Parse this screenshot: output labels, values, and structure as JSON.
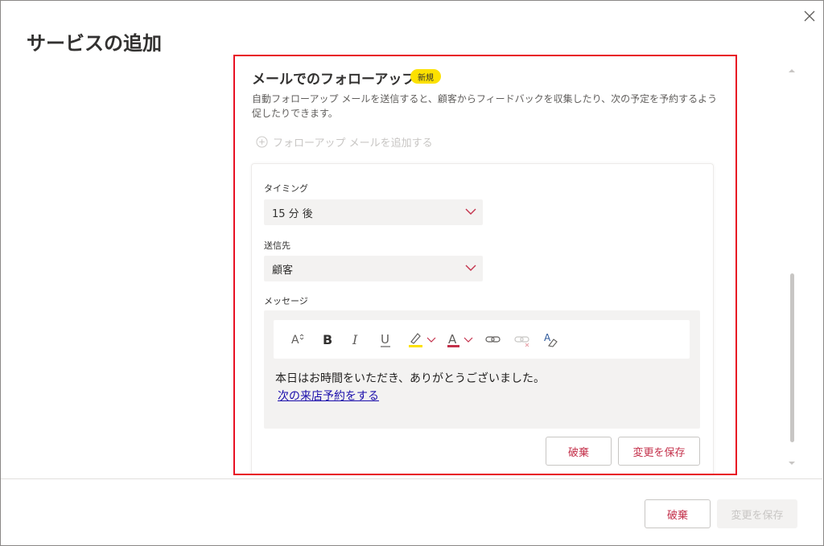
{
  "dialog": {
    "title": "サービスの追加",
    "close_icon": "close-icon"
  },
  "followup": {
    "title": "メールでのフォローアップ",
    "badge": "新規",
    "description": "自動フォローアップ メールを送信すると、顧客からフィードバックを収集したり、次の予定を予約するよう促したりできます。",
    "add_label": "フォローアップ メールを追加する",
    "timing": {
      "label": "タイミング",
      "value": "15 分 後"
    },
    "recipient": {
      "label": "送信先",
      "value": "顧客"
    },
    "message": {
      "label": "メッセージ",
      "body": "本日はお時間をいただき、ありがとうございました。",
      "link": "次の来店予約をする"
    },
    "toolbar": [
      "font-size-icon",
      "bold-icon",
      "italic-icon",
      "underline-icon",
      "highlight-icon",
      "font-color-icon",
      "link-icon",
      "unlink-icon",
      "clear-format-icon"
    ],
    "discard_label": "破棄",
    "save_label": "変更を保存"
  },
  "footer": {
    "discard_label": "破棄",
    "save_label": "変更を保存"
  },
  "colors": {
    "accent_red": "#c4314b",
    "highlight_border": "#e81123",
    "badge_yellow": "#fce100",
    "link_blue": "#1a0dab"
  }
}
